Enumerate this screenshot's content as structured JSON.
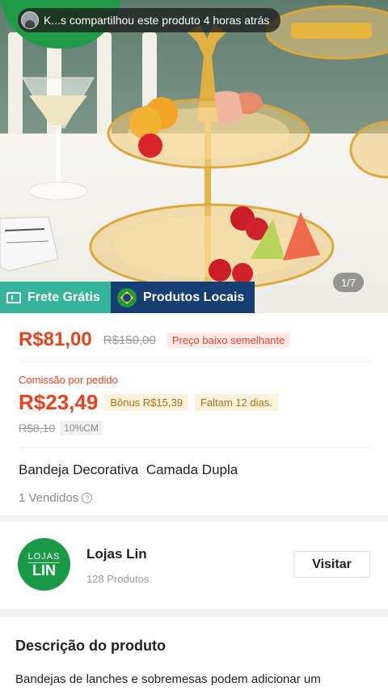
{
  "share_banner": {
    "text": "K...s compartilhou este produto 4 horas atrás"
  },
  "gallery": {
    "page_indicator": "1/7",
    "tags": {
      "frete": "Frete Grátis",
      "locais": "Produtos Locais"
    }
  },
  "pricing": {
    "price": "R$81,00",
    "original_price": "R$150,00",
    "price_badge": "Preço baixo semelhante",
    "commission_label": "Comissão por pedido",
    "commission_value": "R$23,49",
    "bonus": "Bônus R$15,39",
    "days_left": "Faltam 12 dias.",
    "commission_old": "R$8,10",
    "commission_rate": "10%CM"
  },
  "product": {
    "title": "Bandeja Decorativa  Camada Dupla",
    "sold": "1 Vendidos"
  },
  "store": {
    "logo_top": "LOJAS",
    "logo_bottom": "LIN",
    "name": "Lojas Lin",
    "product_count": "128 Produtos",
    "visit_label": "Visitar"
  },
  "description": {
    "title": "Descrição do produto",
    "text": "Bandejas de lanches e sobremesas podem adicionar um"
  },
  "colors": {
    "accent": "#e8421c",
    "frete_tag": "#35b39b",
    "locais_tag": "#163e72",
    "store_logo": "#1a9a46"
  }
}
